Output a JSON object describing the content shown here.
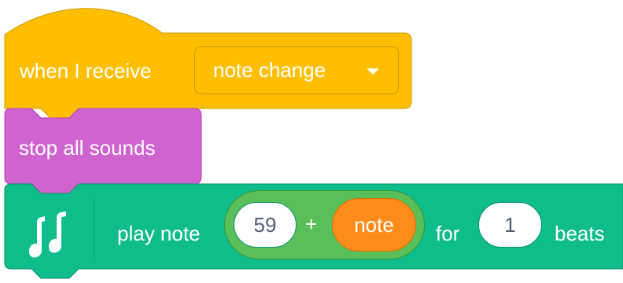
{
  "colors": {
    "events": "#ffbf00",
    "events_border": "#cc9900",
    "sound": "#cf63cf",
    "sound_border": "#bd42bd",
    "music": "#0fbd8c",
    "music_border": "#0b8e69",
    "operators": "#59c059",
    "variables": "#ff8c1a"
  },
  "hat_block": {
    "label": "when I receive",
    "message": "note change",
    "caret_icon": "triangle-down-icon"
  },
  "stop_block": {
    "label": "stop all sounds"
  },
  "play_note_block": {
    "icon": "music-notes-icon",
    "label": "play note",
    "operator": {
      "left_value": "59",
      "sign": "+",
      "right_reporter": "note"
    },
    "for_label": "for",
    "beats_value": "1",
    "beats_label": "beats"
  }
}
